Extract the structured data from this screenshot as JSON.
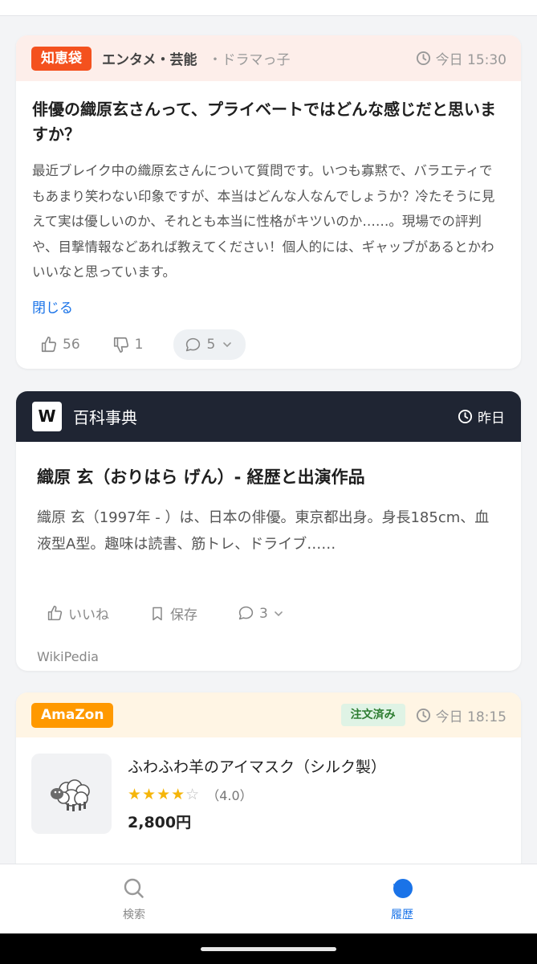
{
  "colors": {
    "chie_badge": "#f4511e",
    "chie_header_bg": "#fdeeea",
    "wiki_header_bg": "#1f2533",
    "amazon_badge": "#ff9900",
    "amazon_header_bg": "#fff5e4",
    "link": "#1a73e8",
    "status_green_bg": "#dff3e5"
  },
  "chie": {
    "badge": "知恵袋",
    "category": "エンタメ・芸能",
    "user": "・ドラマっ子",
    "time": "今日 15:30",
    "title": "俳優の織原玄さんって、プライベートではどんな感じだと思いますか？",
    "body": "最近ブレイク中の織原玄さんについて質問です。いつも寡黙で、バラエティでもあまり笑わない印象ですが、本当はどんな人なんでしょうか？冷たそうに見えて実は優しいのか、それとも本当に性格がキツいのか……。現場での評判や、目撃情報などあれば教えてください！個人的には、ギャップがあるとかわいいなと思っています。",
    "close_label": "閉じる",
    "likes": "56",
    "dislikes": "1",
    "comments": "5"
  },
  "wiki": {
    "logo": "W",
    "label": "百科事典",
    "time": "昨日",
    "title": "織原 玄（おりはら げん）- 経歴と出演作品",
    "body": "織原 玄（1997年 - ）は、日本の俳優。東京都出身。身長185cm、血液型A型。趣味は読書、筋トレ、ドライブ……",
    "like_label": "いいね",
    "save_label": "保存",
    "comments": "3",
    "source": "WikiPedia"
  },
  "amazon": {
    "badge": "AmaZon",
    "status": "注文済み",
    "time": "今日 18:15",
    "product_name": "ふわふわ羊のアイマスク（シルク製）",
    "rating": 4.0,
    "rating_text": "（4.0）",
    "price": "2,800円",
    "thumb_icon": "sheep-icon"
  },
  "nav": {
    "search_label": "検索",
    "history_label": "履歴",
    "active": "history"
  }
}
